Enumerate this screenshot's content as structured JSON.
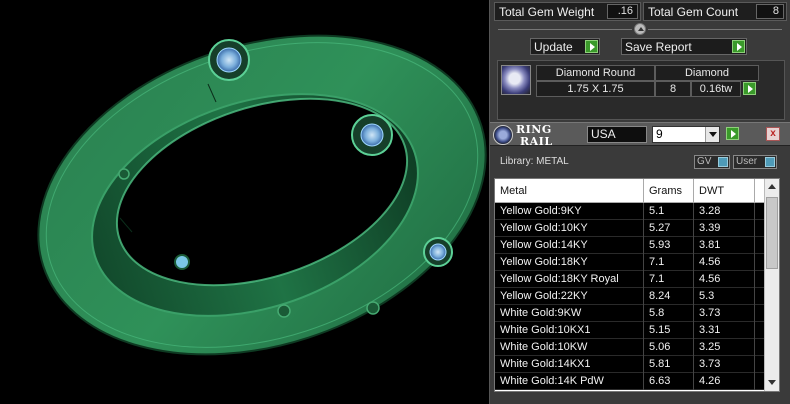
{
  "summary": {
    "total_gem_weight_label": "Total Gem Weight",
    "total_gem_weight_value": ".16",
    "total_gem_count_label": "Total Gem Count",
    "total_gem_count_value": "8"
  },
  "actions": {
    "update_label": "Update",
    "save_report_label": "Save Report"
  },
  "gem": {
    "shape": "Diamond Round",
    "material": "Diamond",
    "size": "1.75 X 1.75",
    "count": "8",
    "weight": "0.16tw"
  },
  "ring_rail": {
    "title_line1": "RING",
    "title_line2": "RAIL",
    "country": "USA",
    "size": "9",
    "close_glyph": "x"
  },
  "library": {
    "label": "Library: METAL",
    "toggle_gv": "GV",
    "toggle_user": "User"
  },
  "table": {
    "columns": [
      "Metal",
      "Grams",
      "DWT"
    ],
    "rows": [
      [
        "Yellow Gold:9KY",
        "5.1",
        "3.28"
      ],
      [
        "Yellow Gold:10KY",
        "5.27",
        "3.39"
      ],
      [
        "Yellow Gold:14KY",
        "5.93",
        "3.81"
      ],
      [
        "Yellow Gold:18KY",
        "7.1",
        "4.56"
      ],
      [
        "Yellow Gold:18KY Royal",
        "7.1",
        "4.56"
      ],
      [
        "Yellow Gold:22KY",
        "8.24",
        "5.3"
      ],
      [
        "White Gold:9KW",
        "5.8",
        "3.73"
      ],
      [
        "White Gold:10KX1",
        "5.15",
        "3.31"
      ],
      [
        "White Gold:10KW",
        "5.06",
        "3.25"
      ],
      [
        "White Gold:14KX1",
        "5.81",
        "3.73"
      ],
      [
        "White Gold:14K PdW",
        "6.63",
        "4.26"
      ]
    ]
  },
  "colors": {
    "ring_green": "#2e8a55",
    "ring_dark": "#123d27",
    "gem_blue": "#7fb0d8",
    "go_green": "#3a9a2a"
  }
}
